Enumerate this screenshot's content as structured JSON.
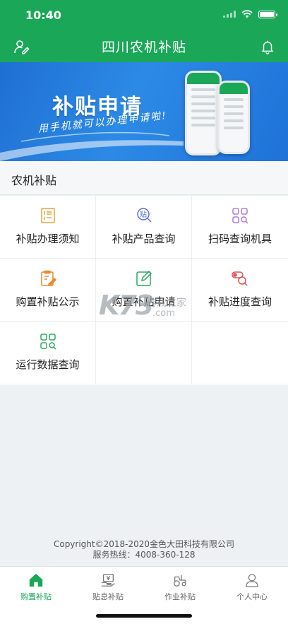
{
  "status_bar": {
    "time": "10:40"
  },
  "nav": {
    "title": "四川农机补贴",
    "left_icon": "user-edit-icon",
    "right_icon": "bell-icon"
  },
  "banner": {
    "title": "补贴申请",
    "subtitle": "用手机就可以办理申请啦!"
  },
  "section": {
    "title": "农机补贴"
  },
  "grid": [
    {
      "label": "补贴办理须知",
      "icon": "document-list-icon",
      "color": "#e8a23a"
    },
    {
      "label": "补贴产品查询",
      "icon": "tag-search-icon",
      "color": "#5b6fd6"
    },
    {
      "label": "扫码查询机具",
      "icon": "grid-search-icon",
      "color": "#b07ad8"
    },
    {
      "label": "购置补贴公示",
      "icon": "clipboard-pen-icon",
      "color": "#e88a2a"
    },
    {
      "label": "购置补贴申请",
      "icon": "edit-icon",
      "color": "#2aa860"
    },
    {
      "label": "补贴进度查询",
      "icon": "progress-search-icon",
      "color": "#e0505a"
    },
    {
      "label": "运行数据查询",
      "icon": "data-search-icon",
      "color": "#2aa860"
    }
  ],
  "watermark": {
    "brand": "K73",
    "cn": "游戏之家",
    "suffix": ".com"
  },
  "footer": {
    "copyright": "Copyright©2018-2020金色大田科技有限公司",
    "hotline": "服务热线：4008-360-128"
  },
  "tabs": [
    {
      "label": "购置补贴",
      "icon": "home-icon",
      "active": true
    },
    {
      "label": "贴息补贴",
      "icon": "money-transfer-icon",
      "active": false
    },
    {
      "label": "作业补贴",
      "icon": "tractor-icon",
      "active": false
    },
    {
      "label": "个人中心",
      "icon": "person-icon",
      "active": false
    }
  ],
  "colors": {
    "brand_green": "#1aa858",
    "banner_blue": "#2c8ae6"
  }
}
